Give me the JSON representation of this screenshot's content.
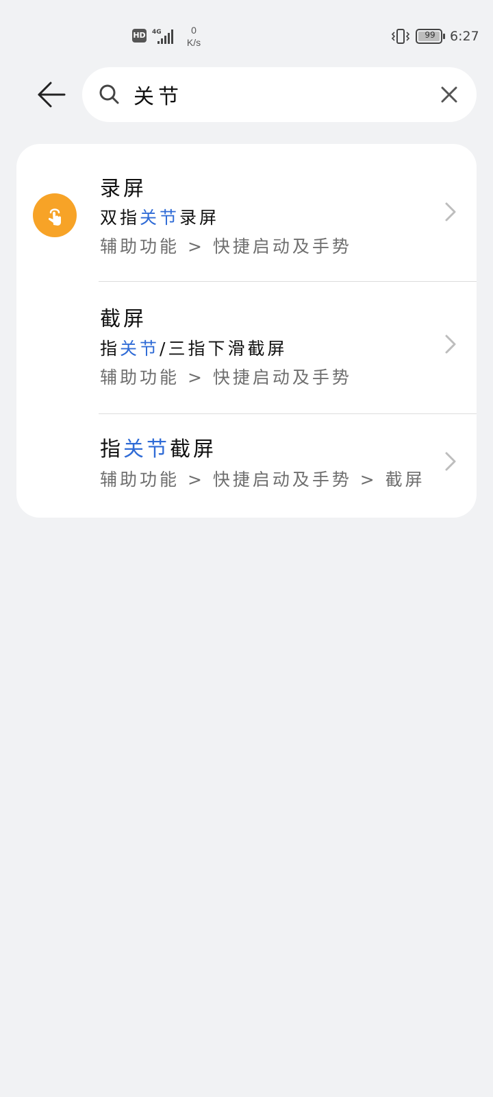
{
  "status_bar": {
    "hd": "HD",
    "network": "4G",
    "speed_value": "0",
    "speed_unit": "K/s",
    "battery": "99",
    "time": "6:27"
  },
  "search": {
    "query": "关节",
    "icons": {
      "back": "back-arrow-icon",
      "search": "search-icon",
      "clear": "close-icon"
    }
  },
  "results": [
    {
      "title": "录屏",
      "line_pre": "双指",
      "line_hl": "关节",
      "line_post": "录屏",
      "path": "辅助功能 > 快捷启动及手势",
      "icon": "tap-gesture-icon"
    },
    {
      "title": "截屏",
      "line_pre": "指",
      "line_hl": "关节",
      "line_post": "/三指下滑截屏",
      "path": "辅助功能 > 快捷启动及手势"
    },
    {
      "title_pre": "指",
      "title_hl": "关节",
      "title_post": "截屏",
      "path": "辅助功能 > 快捷启动及手势 > 截屏"
    }
  ],
  "colors": {
    "background": "#f1f2f4",
    "highlight": "#2f6bd6",
    "icon_accent": "#f7a327"
  }
}
